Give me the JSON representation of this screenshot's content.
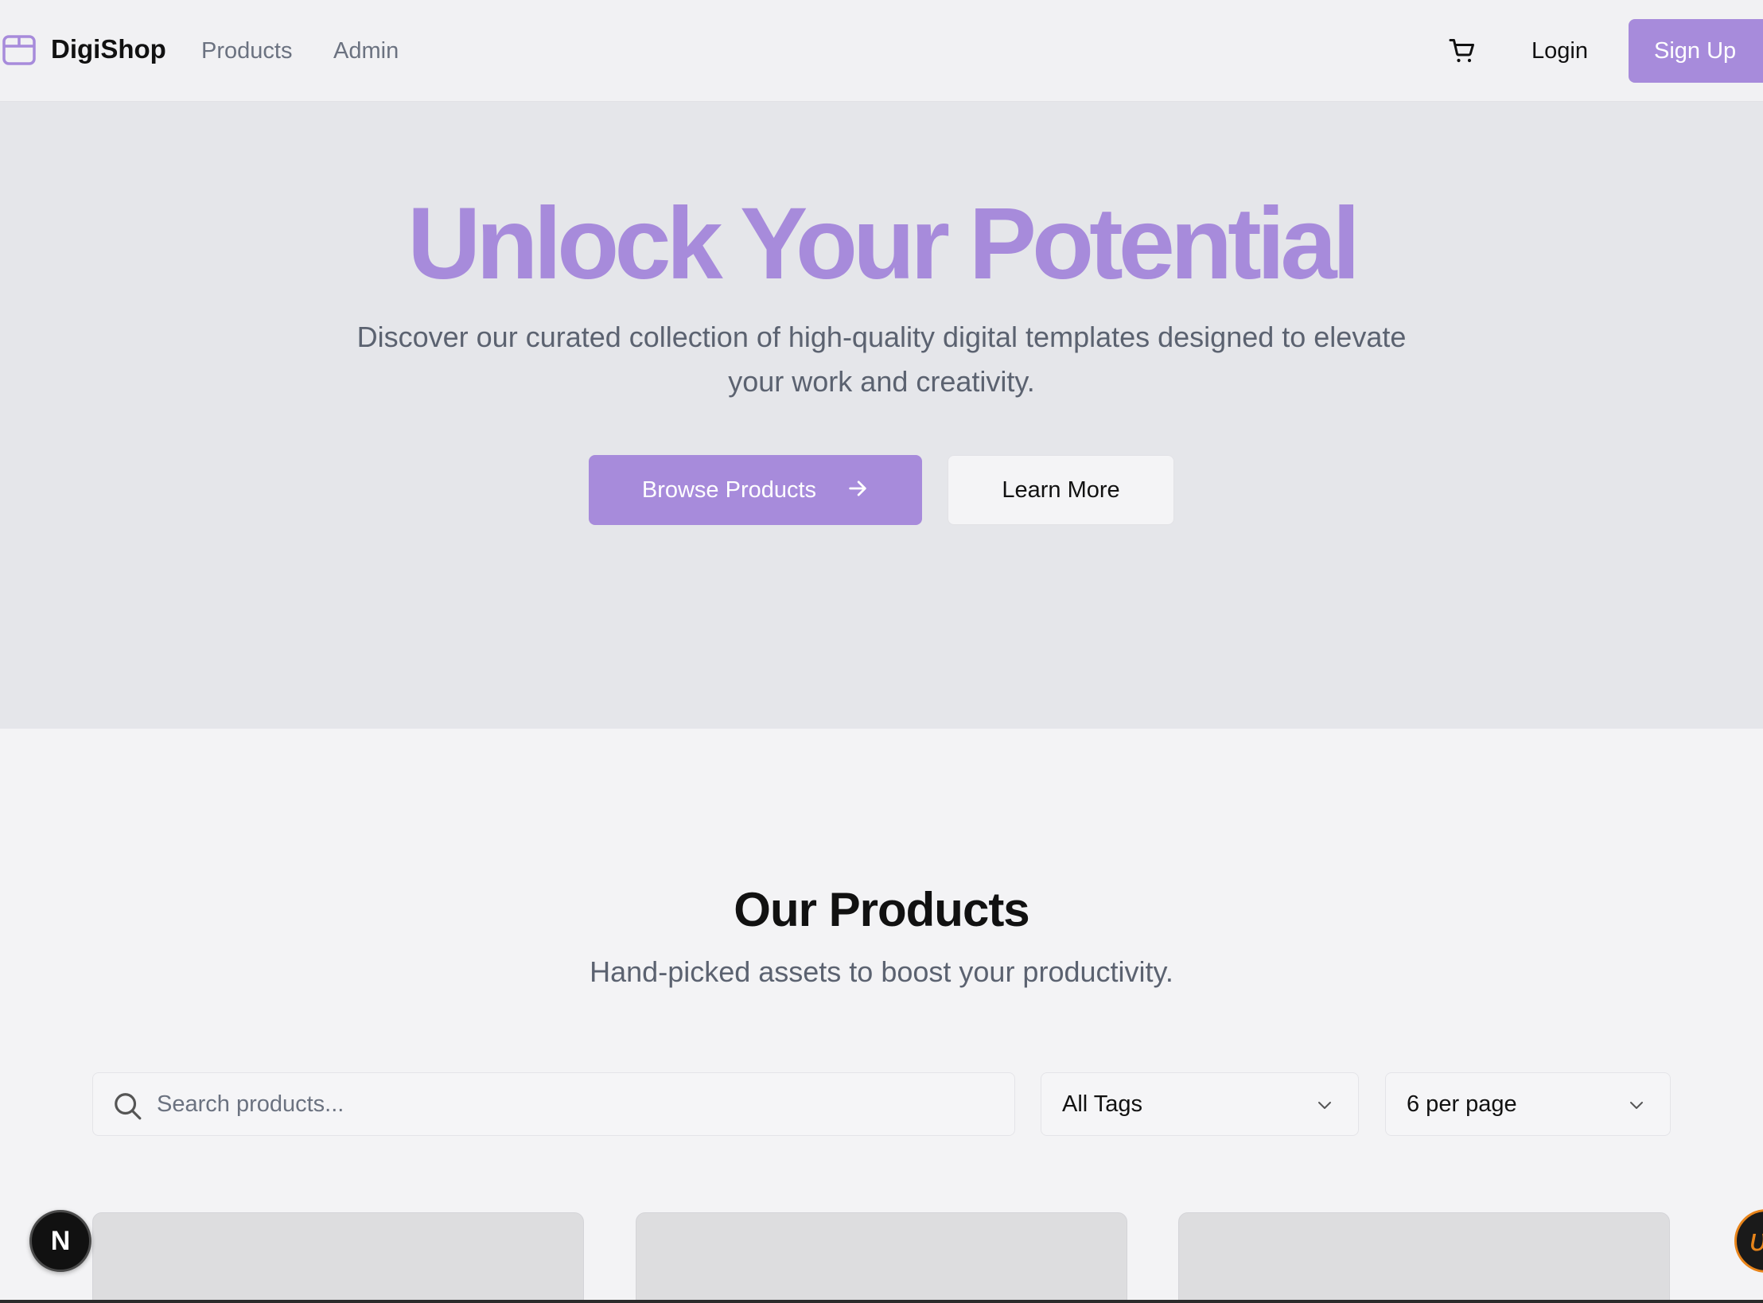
{
  "header": {
    "brand": "DigiShop",
    "nav": [
      {
        "label": "Products"
      },
      {
        "label": "Admin"
      }
    ],
    "login_label": "Login",
    "signup_label": "Sign Up"
  },
  "hero": {
    "title": "Unlock Your Potential",
    "subtitle": "Discover our curated collection of high-quality digital templates designed to elevate your work and creativity.",
    "browse_label": "Browse Products",
    "learn_label": "Learn More"
  },
  "products": {
    "title": "Our Products",
    "subtitle": "Hand-picked assets to boost your productivity.",
    "search_placeholder": "Search products...",
    "tags_selected": "All Tags",
    "per_page_selected": "6 per page"
  },
  "devtools": {
    "next_badge": "N",
    "corner_badge": "ʋ"
  },
  "colors": {
    "accent": "#a78bdb",
    "hero_bg": "#e5e6ea",
    "page_bg": "#f3f3f5"
  },
  "icons": [
    "package-icon",
    "cart-icon",
    "arrow-right-icon",
    "search-icon",
    "chevron-down-icon"
  ]
}
